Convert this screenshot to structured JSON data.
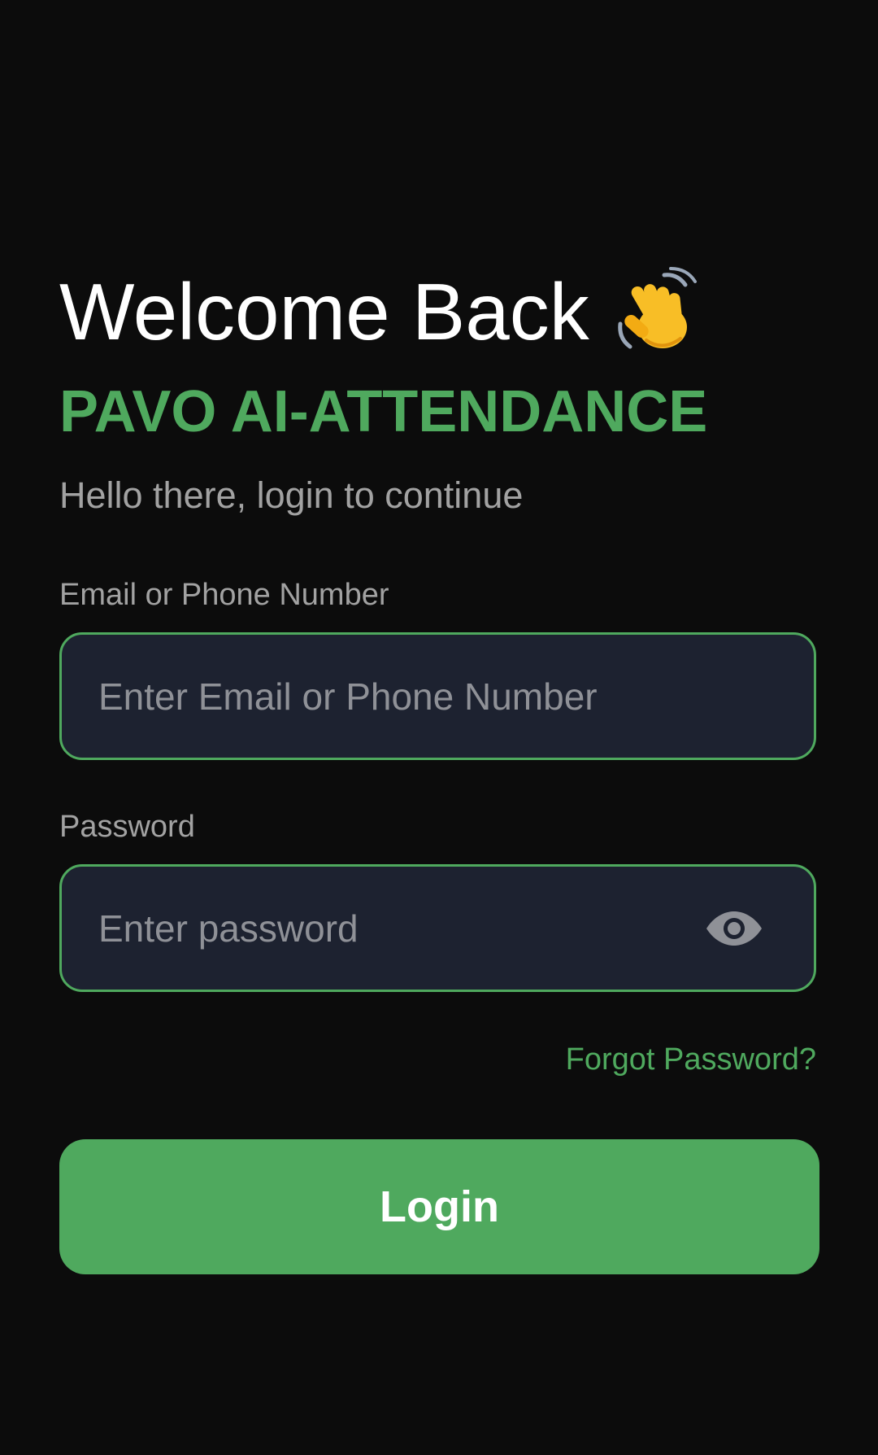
{
  "header": {
    "welcome_text": "Welcome Back",
    "wave_icon": "waving-hand-icon",
    "brand_name": "PAVO AI-ATTENDANCE",
    "subtitle": "Hello there, login to continue"
  },
  "form": {
    "email": {
      "label": "Email or Phone Number",
      "placeholder": "Enter Email or Phone Number",
      "value": ""
    },
    "password": {
      "label": "Password",
      "placeholder": "Enter password",
      "value": "",
      "toggle_icon": "eye-icon"
    },
    "forgot_password": "Forgot Password?",
    "login_label": "Login"
  },
  "colors": {
    "background": "#0c0c0c",
    "accent": "#4fa95e",
    "input_background": "#1d2230",
    "muted_text": "#a2a2a2",
    "placeholder_text": "#8f9197"
  }
}
